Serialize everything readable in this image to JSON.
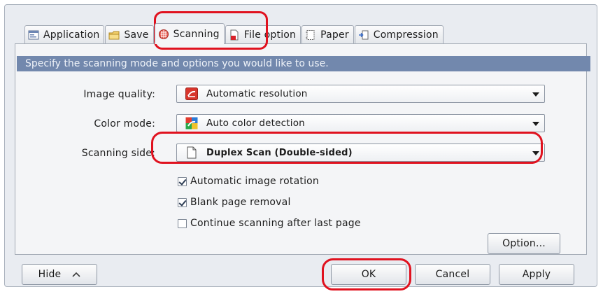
{
  "tabs": [
    {
      "label": "Application",
      "icon": "application-icon"
    },
    {
      "label": "Save",
      "icon": "save-folder-icon"
    },
    {
      "label": "Scanning",
      "icon": "scanning-icon",
      "active": true
    },
    {
      "label": "File option",
      "icon": "file-option-icon"
    },
    {
      "label": "Paper",
      "icon": "paper-icon"
    },
    {
      "label": "Compression",
      "icon": "compression-icon"
    }
  ],
  "banner": "Specify the scanning mode and options you would like to use.",
  "fields": {
    "image_quality": {
      "label": "Image quality:",
      "value": "Automatic resolution"
    },
    "color_mode": {
      "label": "Color mode:",
      "value": "Auto color detection"
    },
    "scanning_side": {
      "label": "Scanning side:",
      "value": "Duplex Scan (Double-sided)"
    }
  },
  "checkboxes": [
    {
      "label": "Automatic image rotation",
      "checked": true
    },
    {
      "label": "Blank page removal",
      "checked": true
    },
    {
      "label": "Continue scanning after last page",
      "checked": false
    }
  ],
  "buttons": {
    "option": "Option...",
    "hide": "Hide",
    "ok": "OK",
    "cancel": "Cancel",
    "apply": "Apply"
  },
  "colors": {
    "highlight": "#e0121f",
    "banner": "#7288ad"
  }
}
